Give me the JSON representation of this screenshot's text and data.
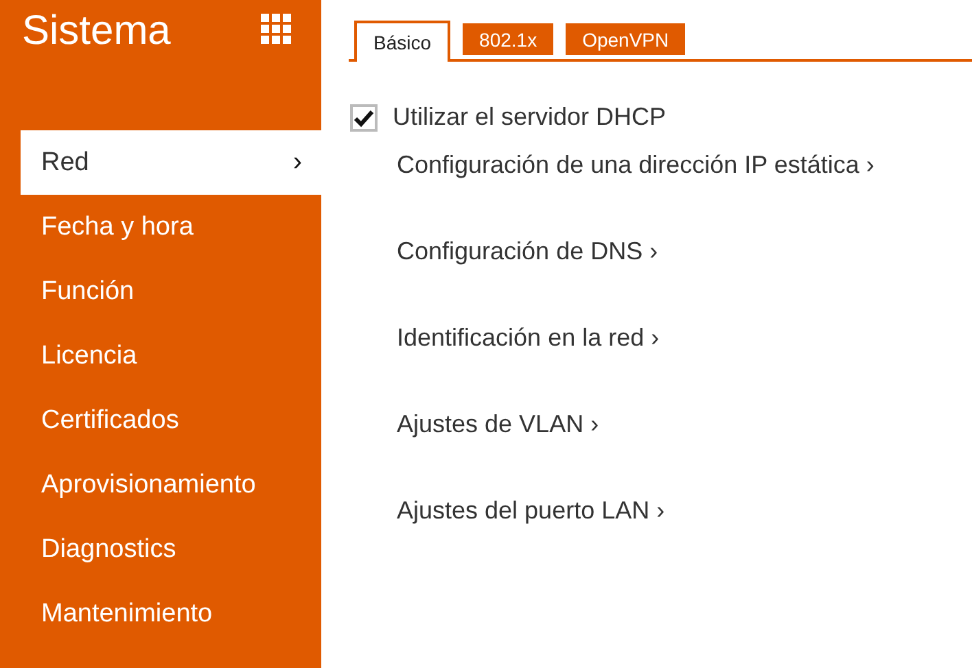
{
  "sidebar": {
    "title": "Sistema",
    "items": [
      {
        "label": "Red",
        "selected": true,
        "chevron": "›"
      },
      {
        "label": "Fecha y hora",
        "selected": false
      },
      {
        "label": "Función",
        "selected": false
      },
      {
        "label": "Licencia",
        "selected": false
      },
      {
        "label": "Certificados",
        "selected": false
      },
      {
        "label": "Aprovisionamiento",
        "selected": false
      },
      {
        "label": "Diagnostics",
        "selected": false
      },
      {
        "label": "Mantenimiento",
        "selected": false
      }
    ]
  },
  "tabs": [
    {
      "label": "Básico",
      "selected": true
    },
    {
      "label": "802.1x",
      "selected": false
    },
    {
      "label": "OpenVPN",
      "selected": false
    }
  ],
  "dhcp": {
    "label": "Utilizar el servidor DHCP",
    "checked": true
  },
  "links": [
    "Configuración de una dirección IP estática ›",
    "Configuración de DNS ›",
    "Identificación en la red ›",
    "Ajustes de VLAN ›",
    "Ajustes del puerto LAN ›"
  ]
}
